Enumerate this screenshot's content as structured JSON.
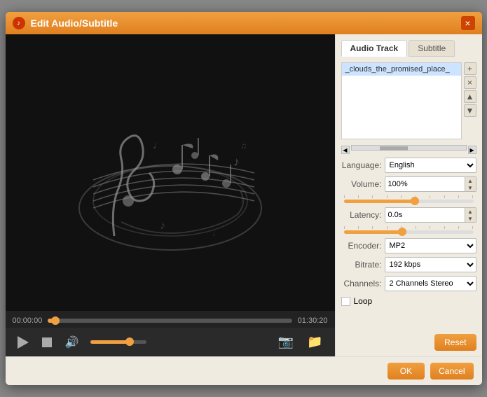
{
  "dialog": {
    "title": "Edit Audio/Subtitle",
    "close_label": "×"
  },
  "tabs": {
    "audio_track_label": "Audio Track",
    "subtitle_label": "Subtitle"
  },
  "track_list": {
    "item": "_clouds_the_promised_place_"
  },
  "track_actions": {
    "add": "+",
    "remove": "×",
    "up": "▲",
    "down": "▼"
  },
  "properties": {
    "language_label": "Language:",
    "language_value": "English",
    "volume_label": "Volume:",
    "volume_value": "100%",
    "latency_label": "Latency:",
    "latency_value": "0.0s",
    "encoder_label": "Encoder:",
    "encoder_value": "MP2",
    "bitrate_label": "Bitrate:",
    "bitrate_value": "192 kbps",
    "channels_label": "Channels:",
    "channels_value": "2 Channels Stereo",
    "loop_label": "Loop"
  },
  "buttons": {
    "reset_label": "Reset",
    "ok_label": "OK",
    "cancel_label": "Cancel"
  },
  "player": {
    "time_current": "00:00:00",
    "time_total": "01:30:20"
  },
  "volume_slider": {
    "percent": 70
  },
  "progress_slider": {
    "percent": 3
  }
}
